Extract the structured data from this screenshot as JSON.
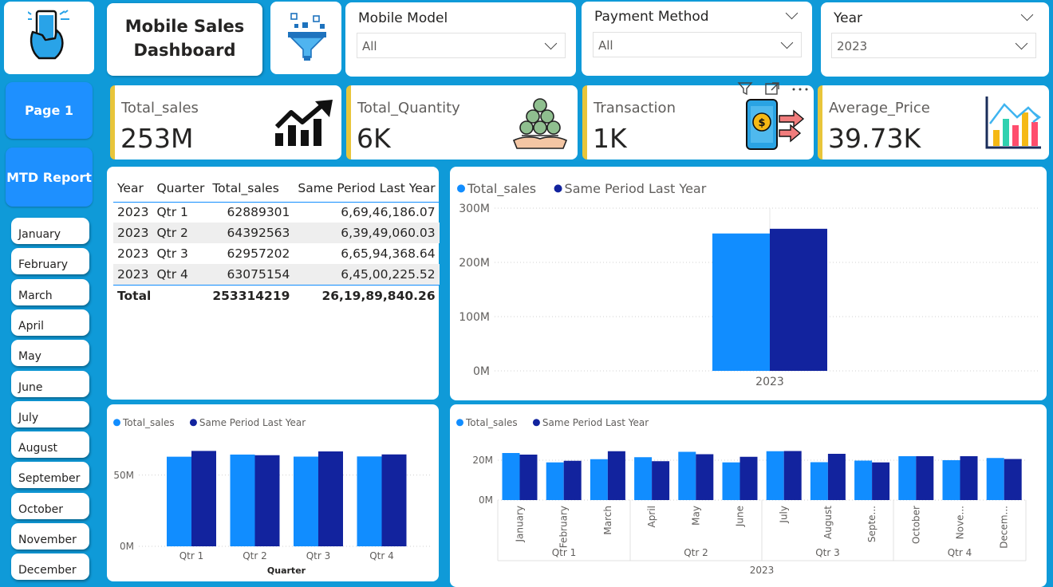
{
  "header": {
    "title_line1": "Mobile Sales",
    "title_line2": "Dashboard"
  },
  "icons": {
    "logo": "mobile-in-hand-icon",
    "filter": "funnel-filter-icon"
  },
  "nav": {
    "page1_label": "Page 1",
    "mtd_label": "MTD Report",
    "months": [
      "January",
      "February",
      "March",
      "April",
      "May",
      "June",
      "July",
      "August",
      "September",
      "October",
      "November",
      "December"
    ]
  },
  "slicers": {
    "mobile_model": {
      "title": "Mobile Model",
      "value": "All"
    },
    "payment_method": {
      "title": "Payment Method",
      "value": "All"
    },
    "year": {
      "title": "Year",
      "value": "2023"
    }
  },
  "kpis": {
    "total_sales": {
      "label": "Total_sales",
      "value": "253M",
      "icon": "trend-up-chart-icon"
    },
    "total_quantity": {
      "label": "Total_Quantity",
      "value": "6K",
      "icon": "coins-in-hand-icon"
    },
    "transaction": {
      "label": "Transaction",
      "value": "1K",
      "icon": "phone-payment-icon"
    },
    "average_price": {
      "label": "Average_Price",
      "value": "39.73K",
      "icon": "bar-chart-icon"
    }
  },
  "visual_header_icons": [
    "filter-icon",
    "focus-mode-icon",
    "more-options-icon"
  ],
  "table": {
    "headers": [
      "Year",
      "Quarter",
      "Total_sales",
      "Same Period Last Year"
    ],
    "rows": [
      [
        "2023",
        "Qtr 1",
        "62889301",
        "6,69,46,186.07"
      ],
      [
        "2023",
        "Qtr 2",
        "64392563",
        "6,39,49,060.03"
      ],
      [
        "2023",
        "Qtr 3",
        "62957202",
        "6,65,94,368.64"
      ],
      [
        "2023",
        "Qtr 4",
        "63075154",
        "6,45,00,225.52"
      ]
    ],
    "total": [
      "Total",
      "253314219",
      "26,19,89,840.26"
    ]
  },
  "colors": {
    "background": "#0f9ad8",
    "series_current": "#118dff",
    "series_previous": "#12239e",
    "kpi_accent": "#e8c53a",
    "nav_button": "#1e90ff"
  },
  "chart_data": [
    {
      "type": "bar",
      "categories": [
        "2023"
      ],
      "series": [
        {
          "name": "Total_sales",
          "values": [
            253314219
          ]
        },
        {
          "name": "Same Period Last Year",
          "values": [
            261989840.26
          ]
        }
      ],
      "yticks": [
        "0M",
        "100M",
        "200M",
        "300M"
      ],
      "ylim": [
        0,
        300000000
      ],
      "legend": "top-left",
      "grid": true
    },
    {
      "type": "bar",
      "categories": [
        "Qtr 1",
        "Qtr 2",
        "Qtr 3",
        "Qtr 4"
      ],
      "series": [
        {
          "name": "Total_sales",
          "values": [
            62889301,
            64392563,
            62957202,
            63075154
          ]
        },
        {
          "name": "Same Period Last Year",
          "values": [
            66946186.07,
            63949060.03,
            66594368.64,
            64500225.52
          ]
        }
      ],
      "xlabel": "Quarter",
      "yticks": [
        "0M",
        "50M"
      ],
      "ylim": [
        0,
        75000000
      ],
      "legend": "top-left",
      "grid": true
    },
    {
      "type": "bar",
      "categories": [
        "January",
        "February",
        "March",
        "April",
        "May",
        "June",
        "July",
        "August",
        "Septe...",
        "October",
        "Nove...",
        "Decem..."
      ],
      "quarters": [
        "Qtr 1",
        "Qtr 2",
        "Qtr 3",
        "Qtr 4"
      ],
      "year": "2023",
      "series": [
        {
          "name": "Total_sales",
          "values": [
            23.6,
            18.9,
            20.5,
            21.5,
            24.2,
            18.9,
            24.5,
            19.0,
            19.8,
            22.0,
            20.0,
            21.1
          ]
        },
        {
          "name": "Same Period Last Year",
          "values": [
            22.8,
            19.7,
            24.5,
            19.5,
            23.0,
            21.7,
            24.6,
            23.2,
            18.9,
            22.0,
            22.0,
            20.6
          ]
        }
      ],
      "value_unit": "M",
      "yticks": [
        "0M",
        "20M"
      ],
      "ylim": [
        0,
        30
      ],
      "legend": "top-left",
      "grid": true
    }
  ]
}
